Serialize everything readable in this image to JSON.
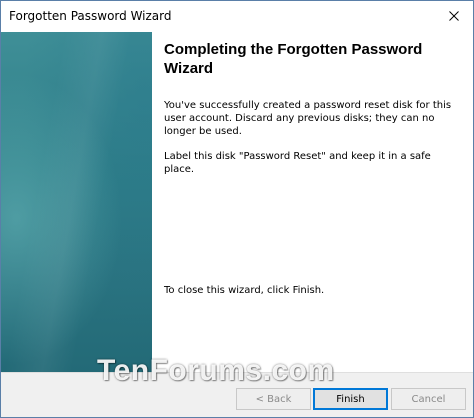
{
  "window": {
    "title": "Forgotten Password Wizard"
  },
  "content": {
    "heading": "Completing the Forgotten Password Wizard",
    "paragraph1": "You've successfully created a password reset disk for this user account. Discard any previous disks; they can no longer be used.",
    "paragraph2": "Label this disk \"Password Reset\" and keep it in a safe place.",
    "closing": "To close this wizard, click Finish."
  },
  "footer": {
    "back_label": "< Back",
    "finish_label": "Finish",
    "cancel_label": "Cancel"
  },
  "watermark": "TenForums.com",
  "colors": {
    "sidebar": "#2f7e88",
    "footer_bg": "#f0f0f0",
    "primary_border": "#0078d7"
  }
}
